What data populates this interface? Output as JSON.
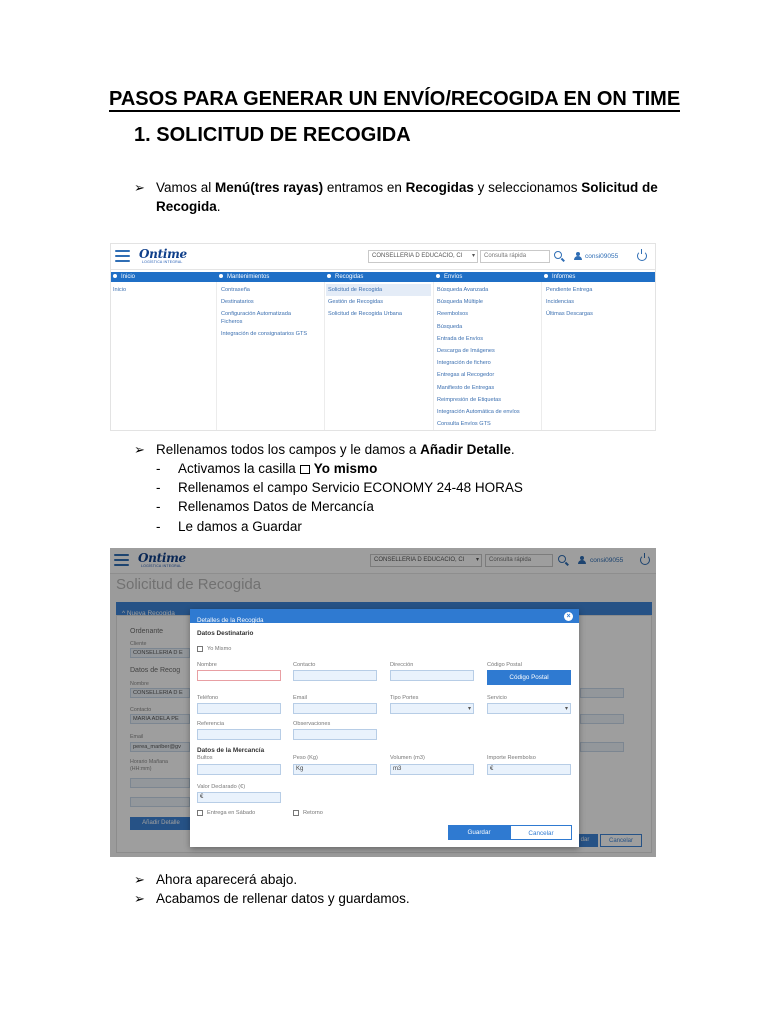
{
  "doc": {
    "title": "PASOS PARA GENERAR UN ENVÍO/RECOGIDA EN ON TIME",
    "section": "1. SOLICITUD DE RECOGIDA",
    "arrow": "➢",
    "dash": "-"
  },
  "step1": {
    "p1": "Vamos al ",
    "b1": "Menú(tres rayas)",
    "p2": " entramos en ",
    "b2": "Recogidas",
    "p3": " y seleccionamos ",
    "b3": "Solicitud de Recogida",
    "p4": "."
  },
  "step2": {
    "p1": "Rellenamos todos los campos y le damos a ",
    "b1": "Añadir Detalle",
    "p2": ".",
    "sub": [
      {
        "pre": "Activamos la casilla",
        "bold": "Yo mismo"
      },
      {
        "text": "Rellenamos el campo Servicio ECONOMY 24-48 HORAS"
      },
      {
        "text": "Rellenamos Datos de Mercancía"
      },
      {
        "text": "Le damos a Guardar"
      }
    ]
  },
  "step3": {
    "line1": "Ahora aparecerá abajo.",
    "line2": "Acabamos de rellenar datos y guardamos."
  },
  "app": {
    "logo": "Ontime",
    "logo_sub": "LOGÍSTICA INTEGRAL",
    "company_select": "CONSELLERIA D EDUCACIO, CI",
    "search_placeholder": "Consulta rápida",
    "username": "consi09055",
    "accent": "#1f6fc6"
  },
  "menu": {
    "columns": [
      {
        "title": "Inicio",
        "items": [
          "Inicio"
        ]
      },
      {
        "title": "Mantenimientos",
        "items": [
          "Contraseña",
          "Destinatarios",
          "Configuración Automatizada Ficheros",
          "Integración de consignatarios GTS"
        ]
      },
      {
        "title": "Recogidas",
        "items": [
          "Solicitud de Recogida",
          "Gestión de Recogidas",
          "Solicitud de Recogida Urbana"
        ],
        "highlight": 0
      },
      {
        "title": "Envíos",
        "items": [
          "Búsqueda Avanzada",
          "Búsqueda Múltiple",
          "Reembolsos",
          "Búsqueda",
          "Entrada de Envíos",
          "Descarga de Imágenes",
          "Integración de fichero",
          "Entregas al Recogedor",
          "Manifiesto de Entregas",
          "Reimpresión de Etiquetas",
          "Integración Automática de envíos",
          "Consulta Envíos GTS"
        ]
      },
      {
        "title": "Informes",
        "items": [
          "Pendiente Entrega",
          "Incidencias",
          "Últimas Descargas"
        ]
      }
    ]
  },
  "form": {
    "page_title": "Solicitud de Recogida",
    "panel_title": "^ Nueva Recogida",
    "ordenante": "Ordenante",
    "cliente_label": "Cliente",
    "cliente_value": "CONSELLERIA D E",
    "datos_recogida": "Datos de Recog",
    "nombre_label": "Nombre",
    "nombre_value": "CONSELLERIA D E",
    "contacto_label": "Contacto",
    "contacto_value": "MARIA ADELA PE",
    "email_label": "Email",
    "email_value": "perea_mariber@gv",
    "horario_label": "Horario Mañana",
    "horario_sub": "(HH:mm)",
    "add_detail": "Añadir Detalle",
    "save_bg": "dar",
    "cancel_bg": "Cancelar"
  },
  "modal": {
    "title": "Detalles de la Recogida",
    "close": "×",
    "datos_destinatario": "Datos Destinatario",
    "yo_mismo": "Yo Mismo",
    "nombre": "Nombre",
    "contacto": "Contacto",
    "direccion": "Dirección",
    "codigo_postal": "Código Postal",
    "codigo_postal_btn": "Código Postal",
    "telefono": "Teléfono",
    "email": "Email",
    "tipo_portes": "Tipo Portes",
    "servicio": "Servicio",
    "referencia": "Referencia",
    "observaciones": "Observaciones",
    "datos_mercancia": "Datos de la Mercancía",
    "bultos": "Bultos",
    "peso": "Peso (Kg)",
    "peso_unit": "Kg",
    "volumen": "Volumen (m3)",
    "volumen_unit": "m3",
    "importe": "Importe Reembolso",
    "importe_unit": "€",
    "valor": "Valor Declarado (€)",
    "valor_unit": "€",
    "entrega_sabado": "Entrega en Sábado",
    "retorno": "Retorno",
    "guardar": "Guardar",
    "cancelar": "Cancelar"
  }
}
